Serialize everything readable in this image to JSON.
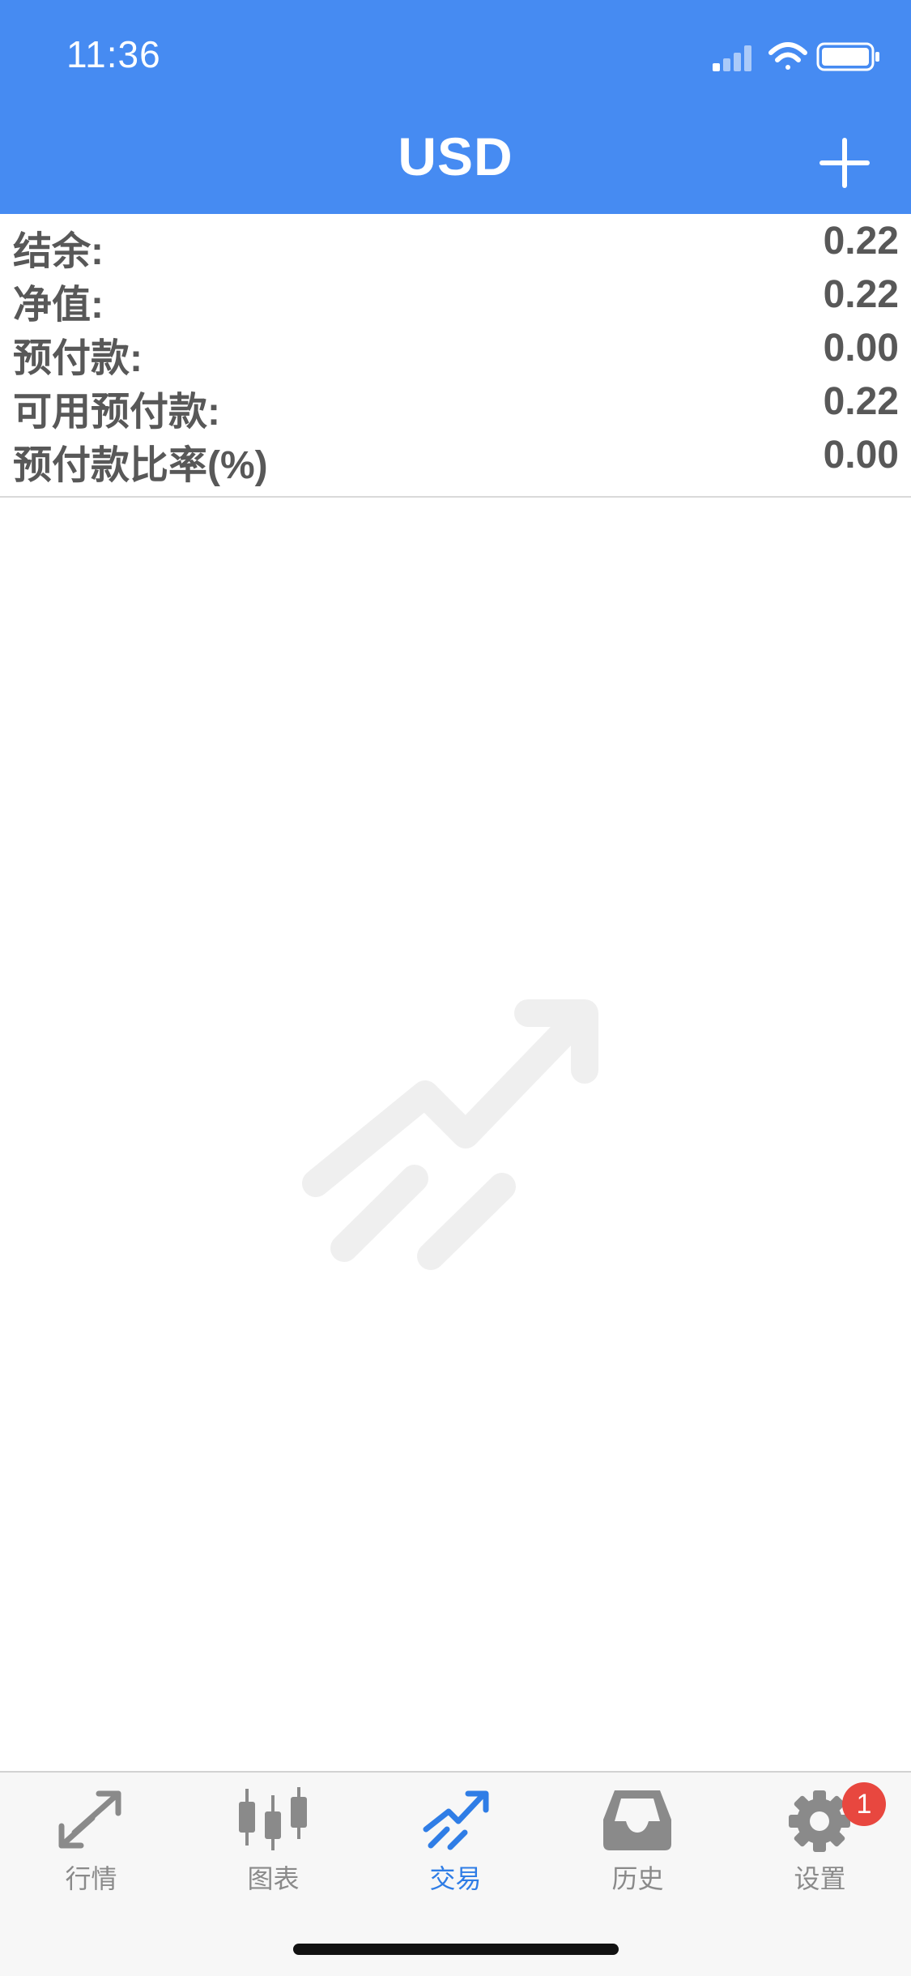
{
  "status_bar": {
    "time": "11:36"
  },
  "header": {
    "title": "USD"
  },
  "summary": [
    {
      "label": "结余:",
      "value": "0.22"
    },
    {
      "label": "净值:",
      "value": "0.22"
    },
    {
      "label": "预付款:",
      "value": "0.00"
    },
    {
      "label": "可用预付款:",
      "value": "0.22"
    },
    {
      "label": "预付款比率(%)",
      "value": "0.00"
    }
  ],
  "tabs": [
    {
      "label": "行情",
      "icon": "quotes-icon"
    },
    {
      "label": "图表",
      "icon": "chart-candles-icon"
    },
    {
      "label": "交易",
      "icon": "trade-icon",
      "active": true
    },
    {
      "label": "历史",
      "icon": "inbox-icon"
    },
    {
      "label": "设置",
      "icon": "gear-icon",
      "badge": "1"
    }
  ],
  "colors": {
    "header_bg": "#468bf2",
    "active_tab": "#2f7de6",
    "inactive_tab": "#8a8a8a",
    "badge": "#e8473f"
  }
}
